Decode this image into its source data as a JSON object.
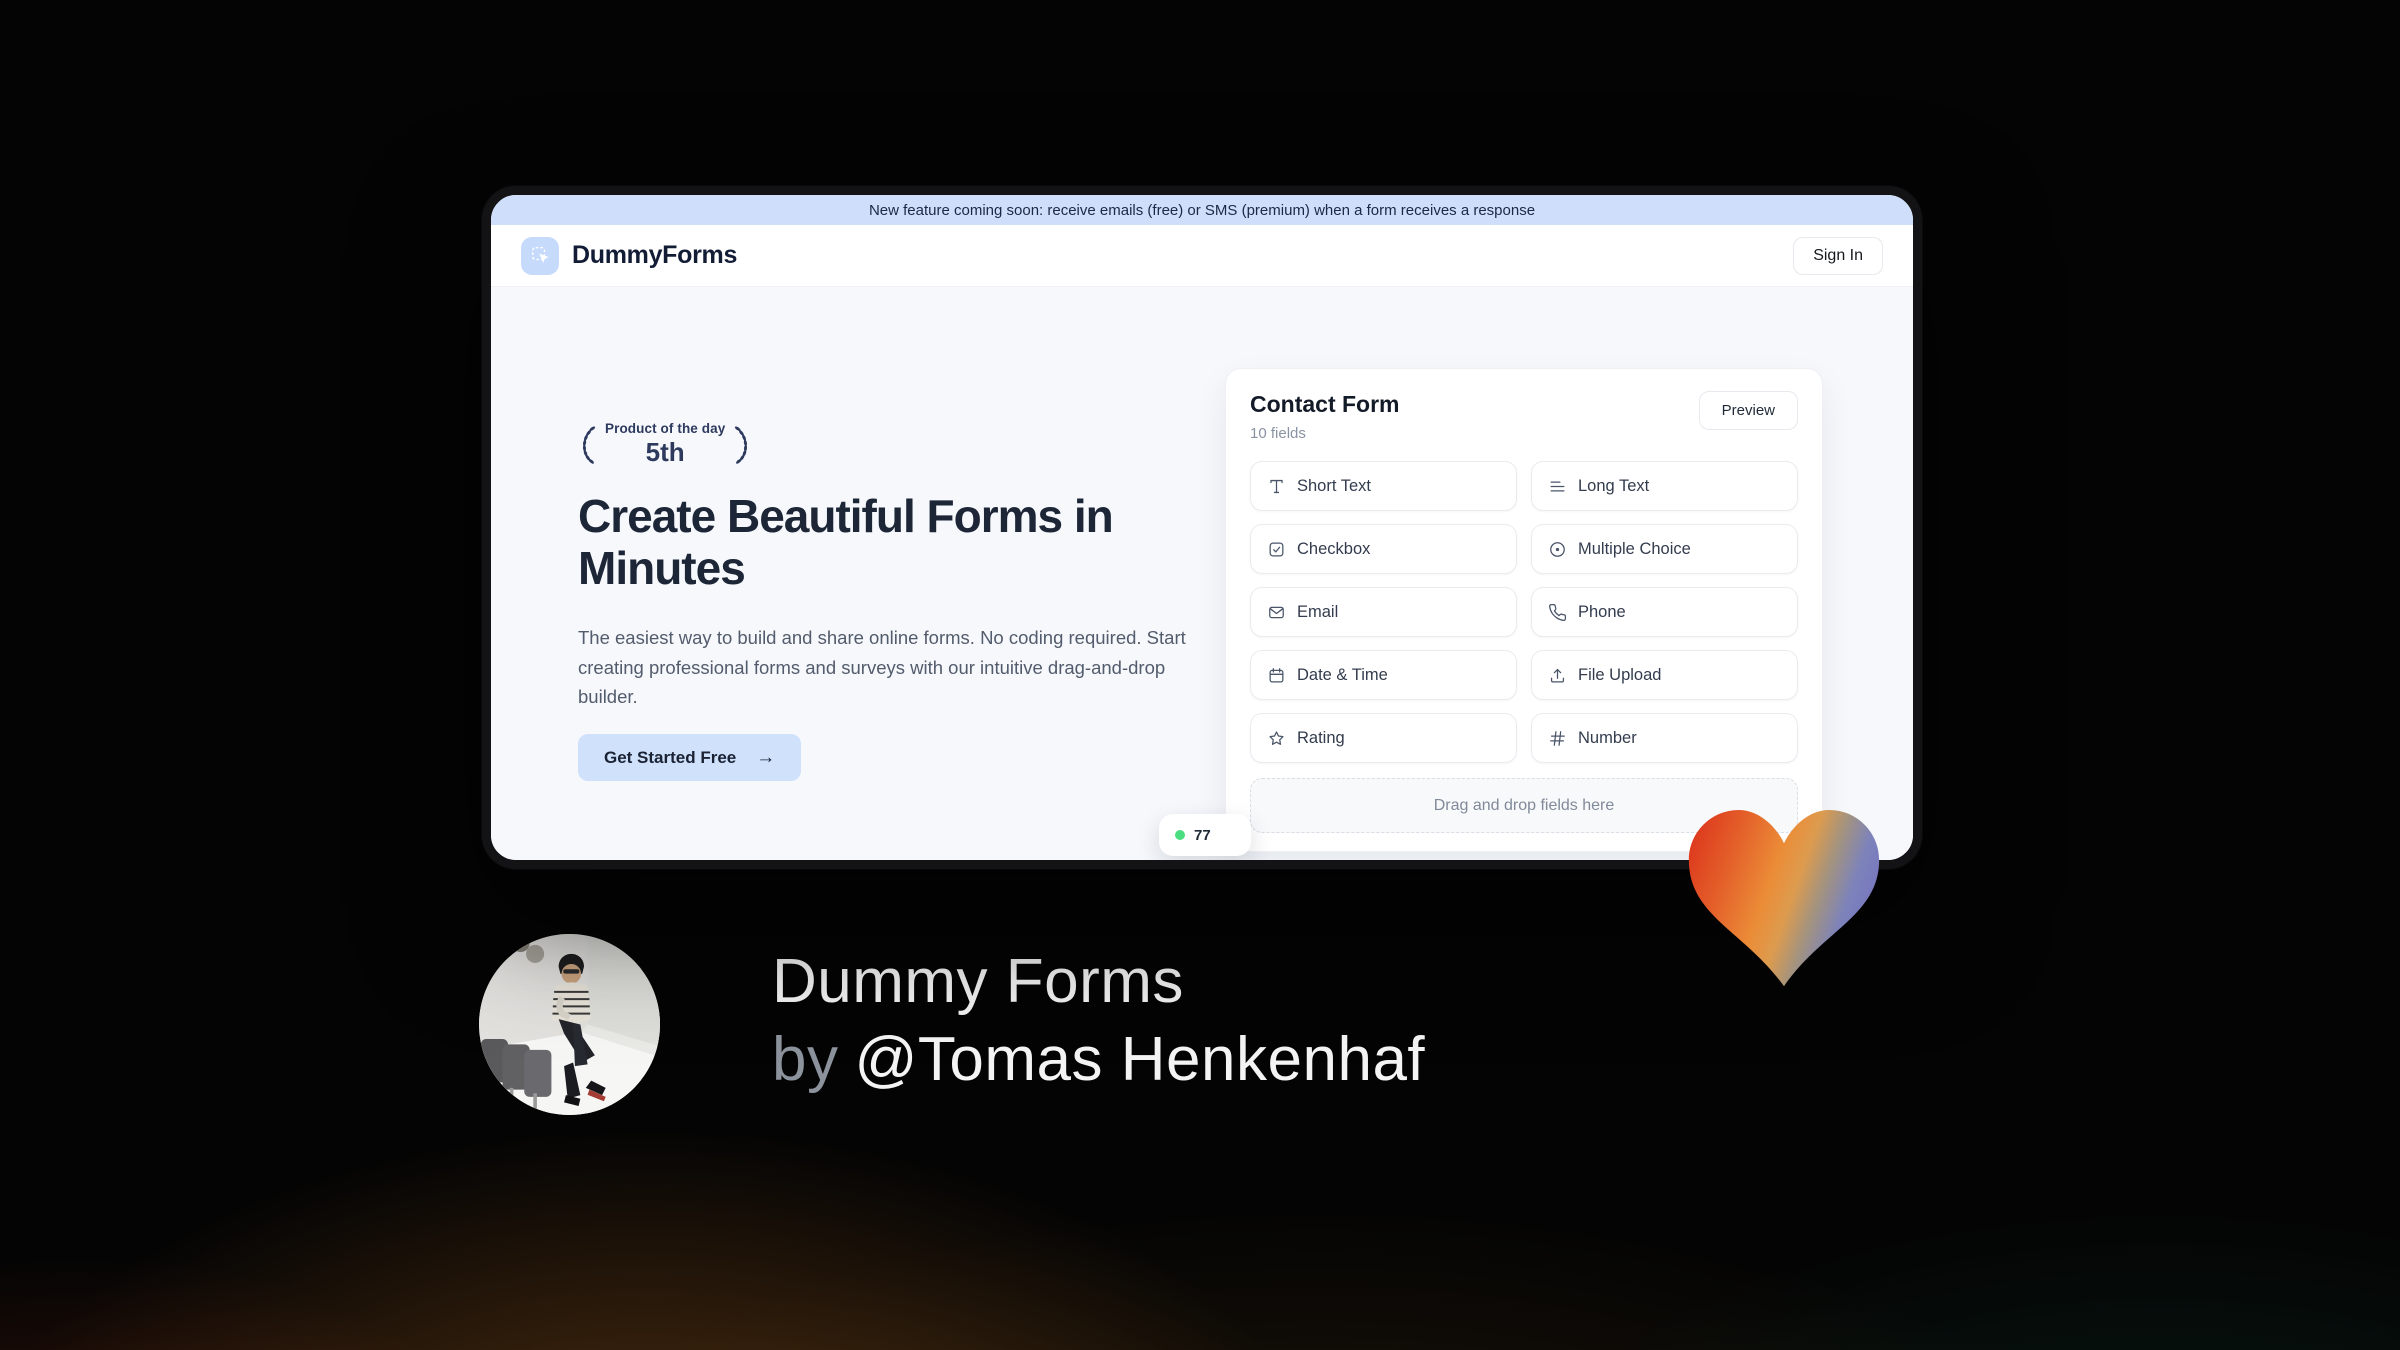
{
  "banner": {
    "text": "New feature coming soon: receive emails (free) or SMS (premium) when a form receives a response"
  },
  "header": {
    "brand": "DummyForms",
    "sign_in_label": "Sign In"
  },
  "hero": {
    "award_title": "Product of the day",
    "award_rank": "5th",
    "title_line1": "Create Beautiful Forms in",
    "title_line2": "Minutes",
    "description": "The easiest way to build and share online forms. No coding required. Start creating professional forms and surveys with our intuitive drag-and-drop builder.",
    "cta_label": "Get Started Free",
    "cta_arrow": "→"
  },
  "form_card": {
    "title": "Contact Form",
    "field_count_label": "10 fields",
    "preview_label": "Preview",
    "fields": [
      {
        "label": "Short Text",
        "icon": "short-text-icon"
      },
      {
        "label": "Long Text",
        "icon": "long-text-icon"
      },
      {
        "label": "Checkbox",
        "icon": "checkbox-icon"
      },
      {
        "label": "Multiple Choice",
        "icon": "multiple-choice-icon"
      },
      {
        "label": "Email",
        "icon": "email-icon"
      },
      {
        "label": "Phone",
        "icon": "phone-icon"
      },
      {
        "label": "Date & Time",
        "icon": "calendar-icon"
      },
      {
        "label": "File Upload",
        "icon": "upload-icon"
      },
      {
        "label": "Rating",
        "icon": "star-icon"
      },
      {
        "label": "Number",
        "icon": "hash-icon"
      }
    ],
    "dropzone_label": "Drag and drop fields here",
    "toast": {
      "visible_text": "77",
      "dot_color": "#4ade80"
    }
  },
  "footer": {
    "product_title": "Dummy Forms",
    "byline_prefix": "by",
    "byline_handle": "@Tomas Henkenhaf"
  },
  "colors": {
    "accent_blue": "#cfe1fb",
    "banner_bg": "#cfdffb",
    "brand_navy": "#1c2637",
    "muted_text": "#535c6c",
    "award_navy": "#2d3a5e",
    "green_dot": "#4ade80",
    "heart_gradient": [
      "#dd3a1e",
      "#eb8c37",
      "#7673c0"
    ],
    "bg_glow_warm": "#a35e1e",
    "bg_glow_teal": "#125c46"
  }
}
